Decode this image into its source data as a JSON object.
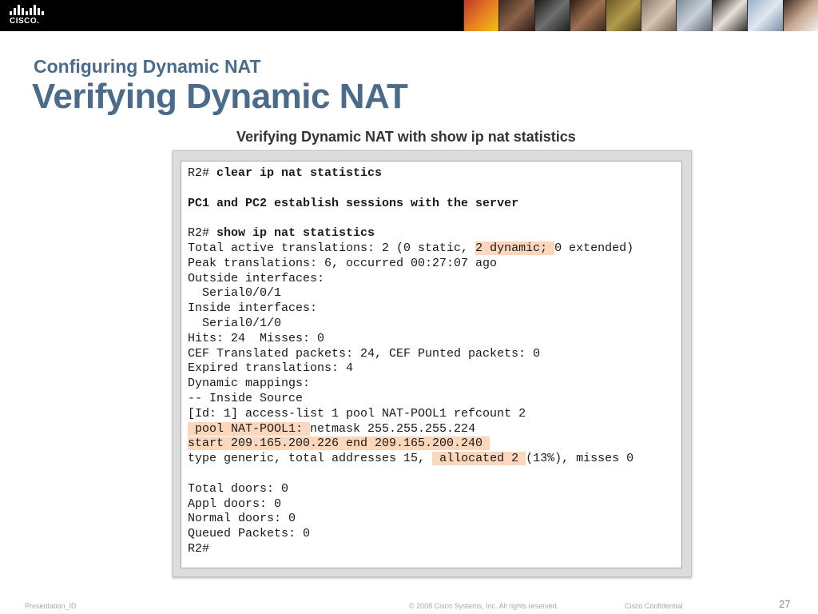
{
  "header": {
    "logo_text": "CISCO."
  },
  "slide": {
    "subtitle": "Configuring Dynamic NAT",
    "title": "Verifying Dynamic NAT",
    "figure_caption": "Verifying Dynamic NAT with show ip nat statistics"
  },
  "terminal": {
    "l1_prompt": "R2# ",
    "l1_cmd": "clear ip nat statistics",
    "l2": "PC1 and PC2 establish sessions with the server",
    "l3_prompt": "R2# ",
    "l3_cmd": "show ip nat statistics",
    "l4_a": "Total active translations: 2 (0 static, ",
    "l4_hl": "2 dynamic; ",
    "l4_b": "0 extended)",
    "l5": "Peak translations: 6, occurred 00:27:07 ago",
    "l6": "Outside interfaces:",
    "l7": "  Serial0/0/1",
    "l8": "Inside interfaces:",
    "l9": "  Serial0/1/0",
    "l10": "Hits: 24  Misses: 0",
    "l11": "CEF Translated packets: 24, CEF Punted packets: 0",
    "l12": "Expired translations: 4",
    "l13": "Dynamic mappings:",
    "l14": "-- Inside Source",
    "l15": "[Id: 1] access-list 1 pool NAT-POOL1 refcount 2",
    "l16_hl": " pool NAT-POOL1: ",
    "l16_b": "netmask 255.255.255.224",
    "l17_hl": "start 209.165.200.226 end 209.165.200.240 ",
    "l18_a": "type generic, total addresses 15, ",
    "l18_hl": " allocated 2 ",
    "l18_b": "(13%), misses 0",
    "l19": "Total doors: 0",
    "l20": "Appl doors: 0",
    "l21": "Normal doors: 0",
    "l22": "Queued Packets: 0",
    "l23": "R2#"
  },
  "footer": {
    "presentation_id": "Presentation_ID",
    "copyright": "© 2008 Cisco Systems, Inc. All rights reserved.",
    "confidential": "Cisco Confidential",
    "page_number": "27"
  },
  "colors": {
    "title": "#4a6b8a",
    "highlight": "#fdd7bb",
    "banner": "#000000"
  }
}
